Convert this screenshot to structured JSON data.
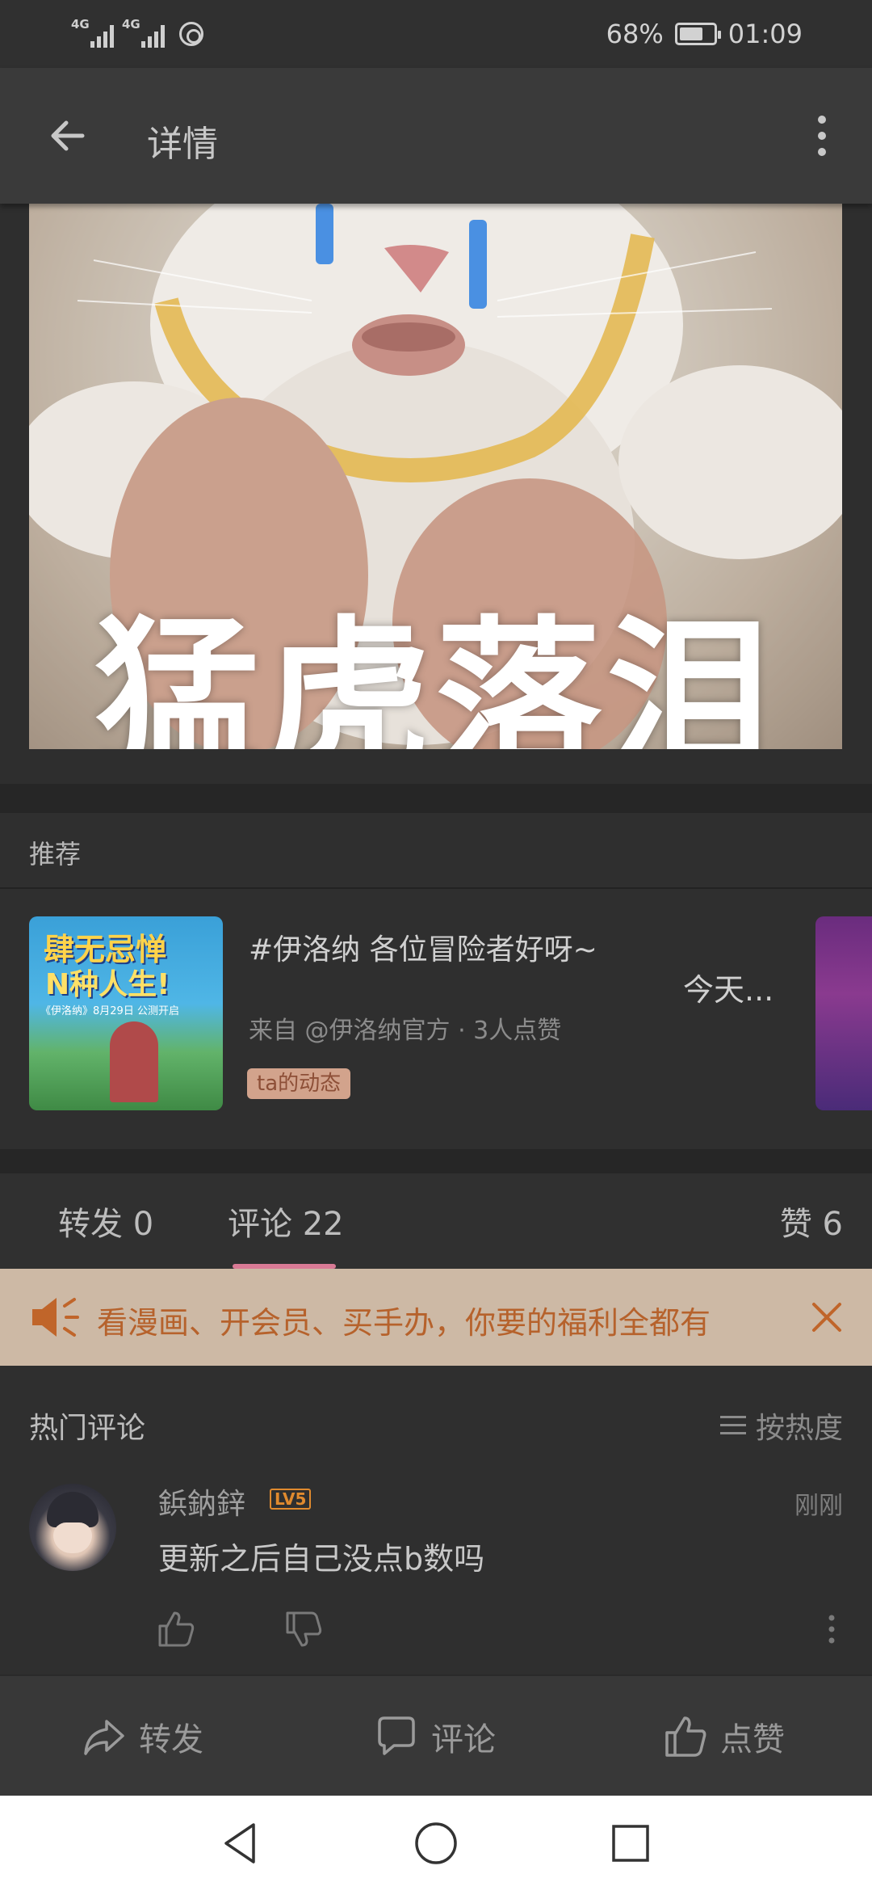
{
  "status_bar": {
    "signal1_label": "4G",
    "signal2_label": "4G",
    "battery_percent": "68%",
    "time": "01:09"
  },
  "app_bar": {
    "title": "详情",
    "back_icon": "arrow-left-icon",
    "more_icon": "more-vertical-icon"
  },
  "post": {
    "image_caption": "猛虎落泪"
  },
  "recommend": {
    "header": "推荐",
    "item": {
      "title": "#伊洛纳 各位冒险者好呀~",
      "meta": "来自 @伊洛纳官方 · 3人点赞",
      "tag": "ta的动态",
      "more": "今天...",
      "thumb_text_1": "肆无忌惮",
      "thumb_text_2": "N种人生!",
      "thumb_text_3": "《伊洛纳》8月29日 公测开启"
    }
  },
  "tabs": {
    "repost": "转发 0",
    "comment": "评论 22",
    "like": "赞 6",
    "active": "comment"
  },
  "promo": {
    "text": "看漫画、开会员、买手办，你要的福利全都有",
    "icon": "speaker-icon",
    "close_icon": "close-icon"
  },
  "comments": {
    "section_title": "热门评论",
    "sort_label": "按热度",
    "items": [
      {
        "username": "鋲鈉鋅",
        "level": "LV5",
        "time": "刚刚",
        "text": "更新之后自己没点b数吗"
      }
    ]
  },
  "action_bar": {
    "repost": "转发",
    "comment": "评论",
    "like": "点赞"
  },
  "colors": {
    "accent": "#d97a95",
    "promo_bg": "#cdb9a5",
    "promo_text": "#b6622c",
    "level": "#e08a2e"
  }
}
